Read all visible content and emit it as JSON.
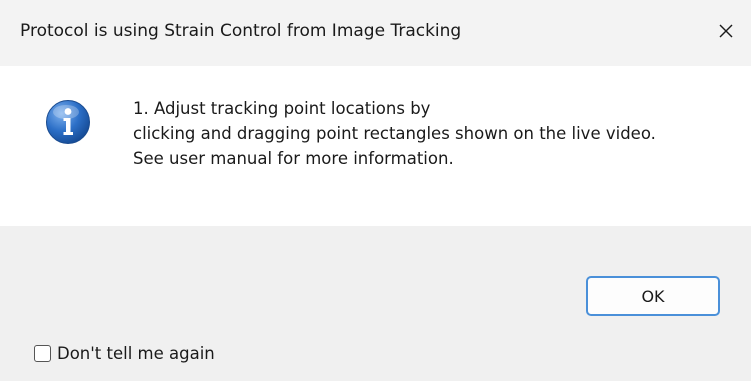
{
  "window": {
    "title": "Protocol is using Strain Control from Image Tracking",
    "close_icon": "close-icon"
  },
  "message": {
    "icon": "info-icon",
    "lines": [
      "1. Adjust tracking point locations by",
      "clicking and dragging point rectangles shown on the live video.",
      "See user manual for more information."
    ]
  },
  "buttons": {
    "ok_label": "OK"
  },
  "checkbox": {
    "label": "Don't tell me again",
    "checked": false
  },
  "colors": {
    "titlebar_bg": "#f3f3f3",
    "footer_bg": "#f0f0f0",
    "accent": "#4a90d9",
    "info_icon_blue": "#1f5fb3"
  }
}
